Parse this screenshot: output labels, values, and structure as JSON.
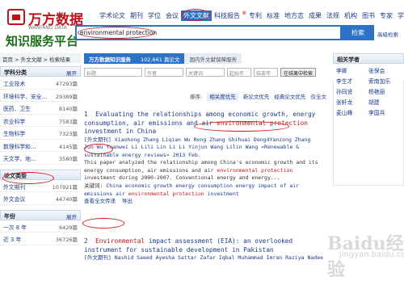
{
  "logo": {
    "name": "万方数据",
    "en": "WANFANG DATA",
    "platform": "知识服务平台"
  },
  "nav": [
    "学术论文",
    "期刊",
    "学位",
    "会议",
    "外文文献",
    "科技报告",
    "专利",
    "标准",
    "地方志",
    "成果",
    "法规",
    "机构",
    "图书",
    "专家",
    "学者"
  ],
  "nav_badge": "新",
  "search": {
    "value": "environmental protection",
    "button": "检索",
    "advanced": "高级检索"
  },
  "breadcrumb": "首页 > 外文文献 > 检索结果",
  "sidebar": {
    "subject_title": "学科分类",
    "expand": "展开",
    "subjects": [
      {
        "label": "工业技术",
        "count": "47293篇"
      },
      {
        "label": "环境科学、安全…",
        "count": "29389篇"
      },
      {
        "label": "医药、卫生",
        "count": "8140篇"
      },
      {
        "label": "农业科学",
        "count": "7583篇"
      },
      {
        "label": "生物科学",
        "count": "7323篇"
      },
      {
        "label": "数理科学和…",
        "count": "4145篇"
      },
      {
        "label": "天文学、地…",
        "count": "3580篇"
      }
    ],
    "type_title": "论文类型",
    "types": [
      {
        "label": "外文期刊",
        "count": "107921篇"
      },
      {
        "label": "外文会议",
        "count": "44740篇"
      }
    ],
    "year_title": "年份",
    "year_expand": "展开",
    "years": [
      {
        "label": "一次 8 年",
        "count": "6429篇"
      },
      {
        "label": "近 3 年",
        "count": "36726篇"
      }
    ]
  },
  "tabs": {
    "t1": "万方数据知识服务",
    "t2": "102,661 篇论文",
    "t3": "国内外文献保障服务"
  },
  "filters": {
    "f1": "标题",
    "f2": "作者",
    "f3": "关键词",
    "f4": "起始年",
    "f5": "结束年",
    "button": "在结果中检索"
  },
  "sort": {
    "label": "排序:",
    "opt1": "相关度优先",
    "opt2": "新论文优先",
    "opt3": "经典论文优先",
    "opt4": "仅全文"
  },
  "results": [
    {
      "no": "1",
      "title_a": "Evaluating the relationships among economic growth, energy consumption, air emissions and air ",
      "title_hl": "environmental protection",
      "title_b": " investment in China",
      "meta_a": "[外文期刊]",
      "authors": "Xiaohong Zhang  Liqian Wu  Rong Zhang  Shihuai Deng4Yanzong Zhang  Jun Wu  Yuanwei Li  Lili Lin  Li Li  Yinjun Wang  Lilin Wang «Renewable & sustainable energy reviews» 2013 Feb.",
      "abs_a": "This paper analyzed the relationship among China's economic growth and its energy consumption, air emissions and air ",
      "abs_hl": "environmental protection",
      "abs_b": " investment during 2000-2007. Conventional energy and energy...",
      "kw_label": "关键词:",
      "keywords": "China  economic growth  energy consumption  energy  impact of air emissions  air ",
      "kw_hl": "environmental protection",
      "kw_b": " investment",
      "link1": "查看全文传递",
      "link2": "导出"
    },
    {
      "no": "2",
      "title_a": "Environmental",
      "title_b": " impact assessment (EIA): an overlooked instrument for sustainable development in Pakistan",
      "meta_a": "[外文期刊]",
      "authors": "Nashid Saeed  Ayesha Sattar  Zafar Iqbal  Muhammad Imran  Raziya Nadeem  «Env"
    }
  ],
  "right": {
    "title": "相关学者",
    "scholars": [
      "李卿",
      "张保会",
      "李生才",
      "索南加乐",
      "孙同贤",
      "杨艳丽",
      "张轩龙",
      "胡建",
      "麦山峰",
      "李国兵"
    ]
  },
  "watermark": "Baidu经验",
  "watermark2": "jingyan.baidu.com"
}
